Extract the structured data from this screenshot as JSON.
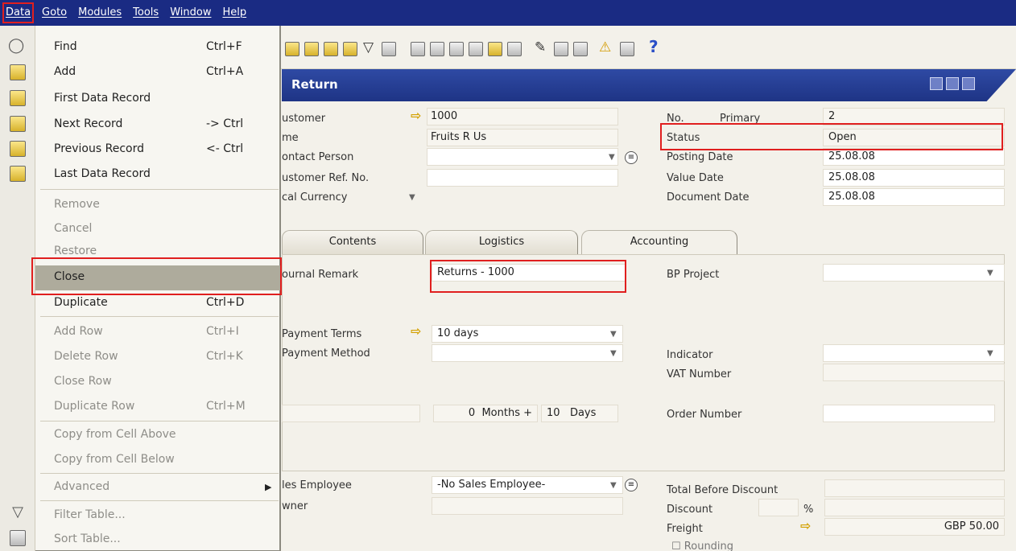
{
  "menubar": {
    "items": [
      "Data",
      "Goto",
      "Modules",
      "Tools",
      "Window",
      "Help"
    ]
  },
  "window": {
    "title": "Return"
  },
  "header_left": {
    "customer_label": "ustomer",
    "customer_value": "1000",
    "name_label": "me",
    "name_value": "Fruits R Us",
    "contact_label": "ontact Person",
    "contact_value": "",
    "ref_label": "ustomer Ref. No.",
    "ref_value": "",
    "currency_label": "cal Currency"
  },
  "header_right": {
    "no_label": "No.",
    "series": "Primary",
    "no_value": "2",
    "status_label": "Status",
    "status_value": "Open",
    "posting_label": "Posting Date",
    "posting_value": "25.08.08",
    "value_label": "Value Date",
    "value_value": "25.08.08",
    "document_label": "Document Date",
    "document_value": "25.08.08"
  },
  "tabs": [
    "Contents",
    "Logistics",
    "Accounting"
  ],
  "accounting": {
    "journal_label": "ournal Remark",
    "journal_value": "Returns - 1000",
    "bp_project_label": "BP Project",
    "payment_terms_label": "Payment Terms",
    "payment_terms_value": "10 days",
    "payment_method_label": "Payment Method",
    "indicator_label": "Indicator",
    "vat_label": "VAT Number",
    "months_value": "0",
    "months_label": "Months +",
    "days_value": "10",
    "days_label": "Days",
    "order_label": "Order Number"
  },
  "footer": {
    "sales_employee_label": "les Employee",
    "sales_employee_value": "-No Sales Employee-",
    "owner_label": "wner",
    "total_before_discount_label": "Total Before Discount",
    "discount_label": "Discount",
    "discount_pct": "%",
    "freight_label": "Freight",
    "freight_value": "GBP 50.00",
    "rounding_label": "Rounding"
  },
  "data_menu": {
    "items": [
      {
        "label": "Find",
        "shortcut": "Ctrl+F"
      },
      {
        "label": "Add",
        "shortcut": "Ctrl+A"
      },
      {
        "label": "First Data Record",
        "shortcut": ""
      },
      {
        "label": "Next Record",
        "shortcut": "-> Ctrl"
      },
      {
        "label": "Previous Record",
        "shortcut": "<- Ctrl"
      },
      {
        "label": "Last Data Record",
        "shortcut": ""
      },
      {
        "label": "Remove",
        "shortcut": ""
      },
      {
        "label": "Cancel",
        "shortcut": ""
      },
      {
        "label": "Restore",
        "shortcut": ""
      },
      {
        "label": "Close",
        "shortcut": ""
      },
      {
        "label": "Duplicate",
        "shortcut": "Ctrl+D"
      },
      {
        "label": "Add Row",
        "shortcut": "Ctrl+I"
      },
      {
        "label": "Delete Row",
        "shortcut": "Ctrl+K"
      },
      {
        "label": "Close Row",
        "shortcut": ""
      },
      {
        "label": "Duplicate Row",
        "shortcut": "Ctrl+M"
      },
      {
        "label": "Copy from Cell Above",
        "shortcut": ""
      },
      {
        "label": "Copy from Cell Below",
        "shortcut": ""
      },
      {
        "label": "Advanced",
        "shortcut": ""
      },
      {
        "label": "Filter Table...",
        "shortcut": ""
      },
      {
        "label": "Sort Table...",
        "shortcut": ""
      }
    ]
  },
  "colors": {
    "menubar_bg": "#1a2b83",
    "highlight": "#e01f1f",
    "selected_item": "#aeab9c"
  }
}
